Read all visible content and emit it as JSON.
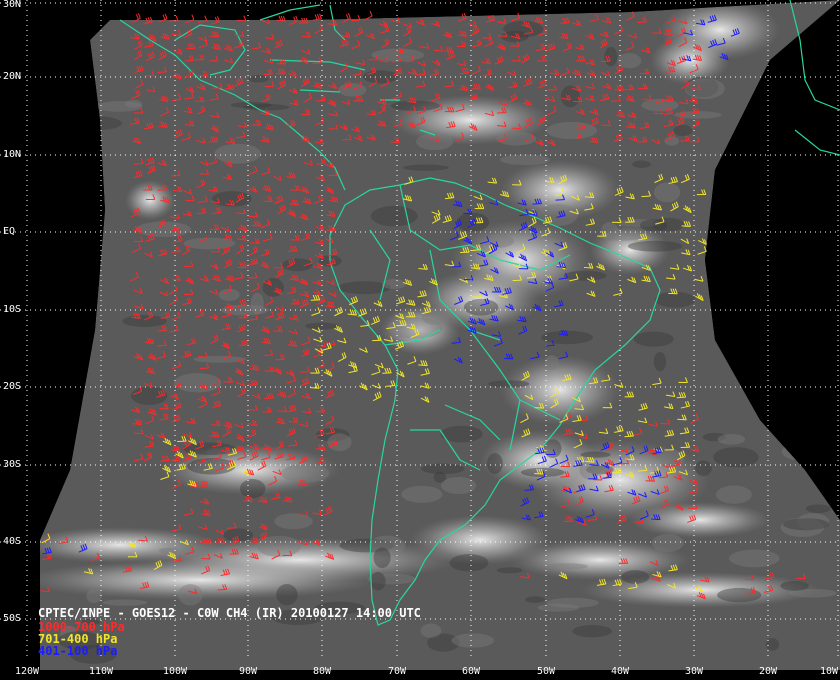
{
  "caption": "CPTEC/INPE - GOES12 - C0W CH4 (IR) 20100127 14:00 UTC",
  "legend": [
    {
      "label": "1000-700 hPa",
      "color": "#ff2a2a"
    },
    {
      "label": "701-400 hPa",
      "color": "#f2e62a"
    },
    {
      "label": "401-100 hPa",
      "color": "#1c1cff"
    }
  ],
  "latitude_labels": [
    "30N",
    "20N",
    "10N",
    "EQ",
    "10S",
    "20S",
    "30S",
    "40S",
    "50S"
  ],
  "longitude_labels": [
    "120W",
    "110W",
    "100W",
    "90W",
    "80W",
    "70W",
    "60W",
    "50W",
    "40W",
    "30W",
    "20W",
    "10W"
  ],
  "colors": {
    "background": "#000000",
    "coastline": "#28d6a0",
    "graticule": "#ffffff",
    "label_text": "#ffffff"
  }
}
